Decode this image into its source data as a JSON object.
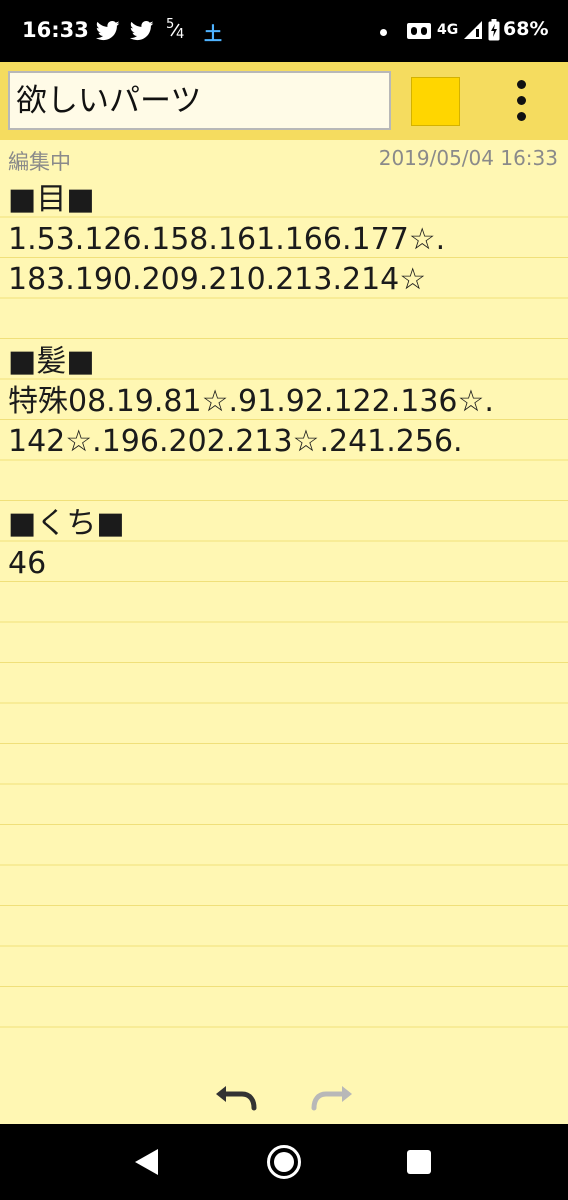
{
  "status_bar": {
    "time": "16:33",
    "date_top": "5",
    "date_bottom": "4",
    "day": "土",
    "network": "4G",
    "battery": "68%"
  },
  "toolbar": {
    "title": "欲しいパーツ",
    "swatch_color": "#ffd600"
  },
  "meta": {
    "status": "編集中",
    "timestamp": "2019/05/04 16:33"
  },
  "note": {
    "lines": [
      "■目■",
      "1.53.126.158.161.166.177☆.",
      "183.190.209.210.213.214☆",
      "",
      "■髪■",
      "特殊08.19.81☆.91.92.122.136☆.",
      "142☆.196.202.213☆.241.256.",
      "",
      "■くち■",
      "46"
    ]
  },
  "icons": {
    "status": [
      "twitter-icon",
      "twitter-icon",
      "dot-icon",
      "voice-over-lte-icon",
      "signal-icon",
      "battery-icon"
    ],
    "toolbar": [
      "color-swatch",
      "more-vert-icon"
    ],
    "edit": [
      "undo-icon",
      "redo-icon"
    ],
    "nav": [
      "back-icon",
      "home-icon",
      "recents-icon"
    ]
  }
}
